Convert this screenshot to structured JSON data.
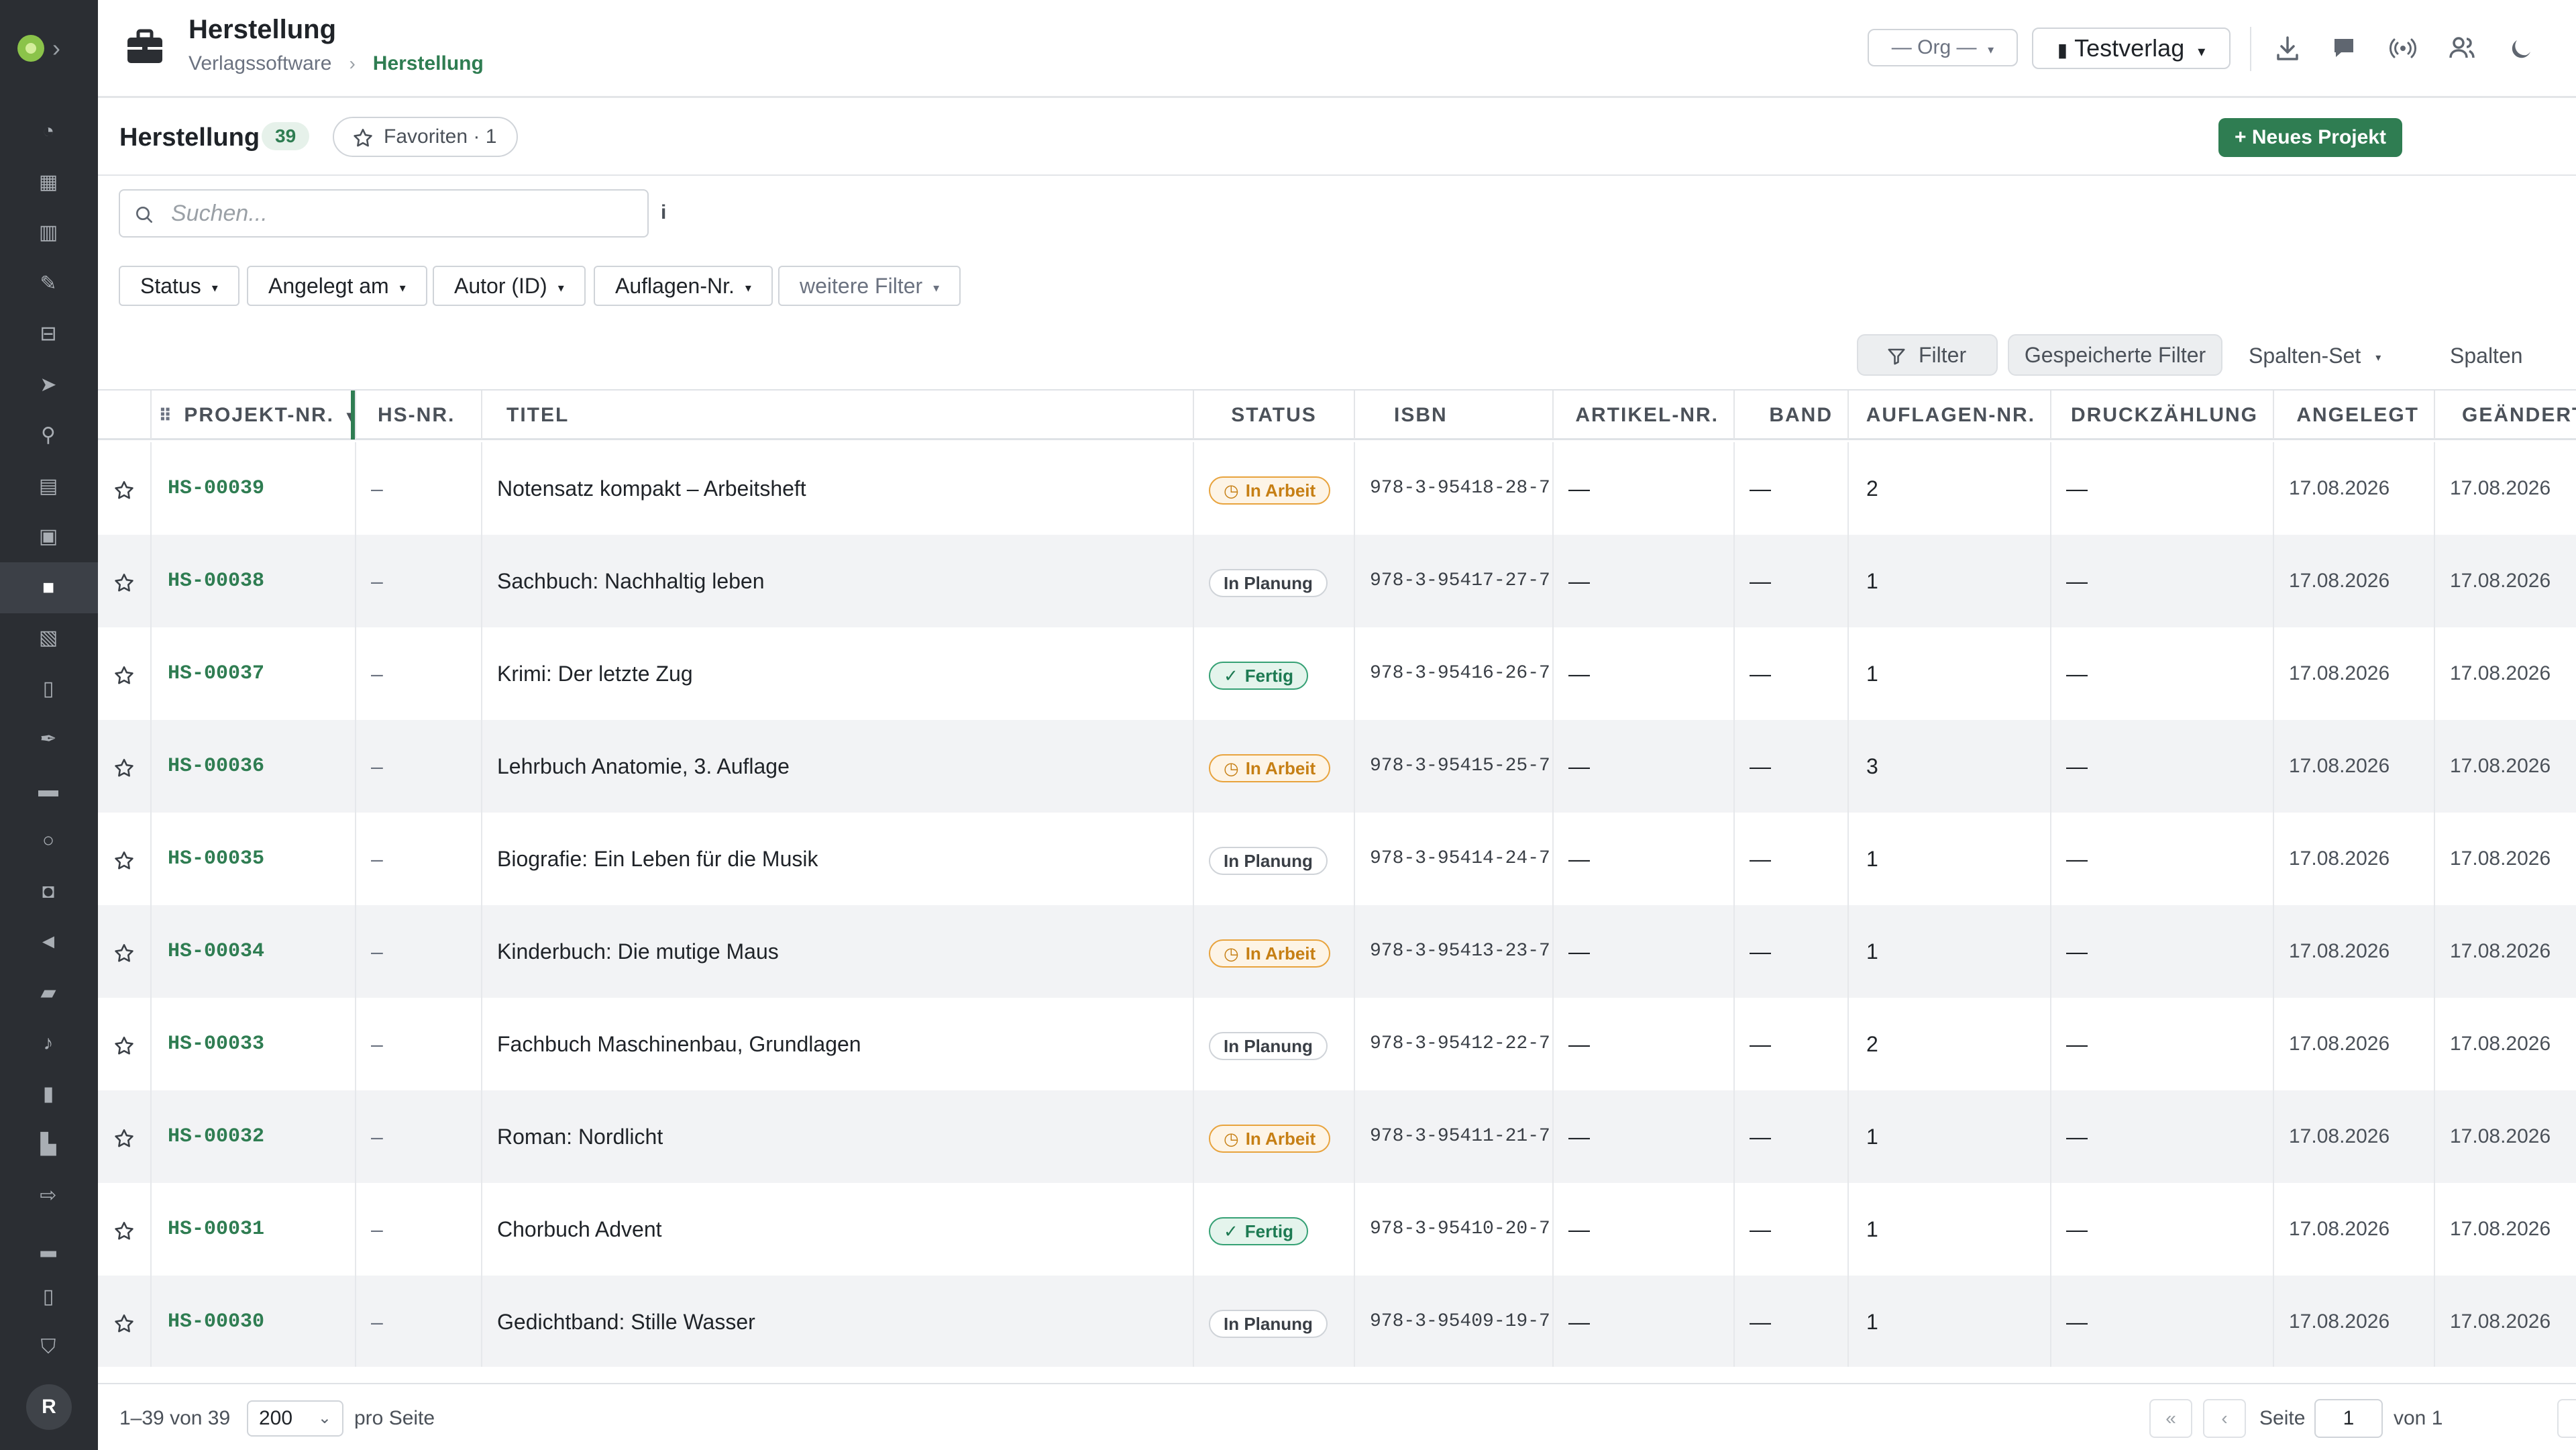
{
  "header": {
    "title": "Herstellung",
    "breadcrumb": [
      "Verlagssoftware",
      "Herstellung"
    ],
    "org_select": "— Org —",
    "publisher_select": "Testverlag"
  },
  "sidebar": {
    "icons": [
      "dashboard-icon",
      "calendar-icon",
      "board-icon",
      "user-edit-icon",
      "inbox-icon",
      "send-icon",
      "lightbulb-icon",
      "library-icon",
      "image-icon",
      "briefcase-icon",
      "card-icon",
      "book-icon",
      "feather-icon",
      "truck-icon",
      "circle-icon",
      "bag-icon",
      "megaphone-icon",
      "ticket-icon",
      "music-icon",
      "file-icon",
      "store-icon",
      "transfer-icon",
      "chart-icon",
      "receipt-icon",
      "shield-icon"
    ],
    "active_index": 9,
    "avatar": "R"
  },
  "toolbar": {
    "title": "Herstellung",
    "count": "39",
    "favorites": "Favoriten · 1",
    "new_project": "+ Neues Projekt",
    "more": "···"
  },
  "search": {
    "placeholder": "Suchen...",
    "info": "i"
  },
  "filters": {
    "chips": [
      "Status",
      "Angelegt am",
      "Autor (ID)",
      "Auflagen-Nr.",
      "weitere Filter"
    ],
    "filter_btn": "Filter",
    "saved_filters": "Gespeicherte Filter",
    "column_set": "Spalten-Set",
    "columns": "Spalten"
  },
  "table": {
    "columns": [
      "PROJEKT-NR.",
      "HS-NR.",
      "TITEL",
      "STATUS",
      "ISBN",
      "ARTIKEL-NR.",
      "BAND",
      "AUFLAGEN-NR.",
      "DRUCKZÄHLUNG",
      "ANGELEGT",
      "GEÄNDERT"
    ],
    "status_labels": {
      "arbeit": "In Arbeit",
      "planung": "In Planung",
      "fertig": "Fertig"
    },
    "rows": [
      {
        "pid": "HS-00039",
        "hs": "–",
        "title": "Notensatz kompakt – Arbeitsheft",
        "status": "arbeit",
        "isbn": "978-3-95418-28-7",
        "art": "—",
        "band": "—",
        "aufl": "2",
        "druck": "—",
        "created": "17.08.2026",
        "changed": "17.08.2026"
      },
      {
        "pid": "HS-00038",
        "hs": "–",
        "title": "Sachbuch: Nachhaltig leben",
        "status": "planung",
        "isbn": "978-3-95417-27-7",
        "art": "—",
        "band": "—",
        "aufl": "1",
        "druck": "—",
        "created": "17.08.2026",
        "changed": "17.08.2026"
      },
      {
        "pid": "HS-00037",
        "hs": "–",
        "title": "Krimi: Der letzte Zug",
        "status": "fertig",
        "isbn": "978-3-95416-26-7",
        "art": "—",
        "band": "—",
        "aufl": "1",
        "druck": "—",
        "created": "17.08.2026",
        "changed": "17.08.2026"
      },
      {
        "pid": "HS-00036",
        "hs": "–",
        "title": "Lehrbuch Anatomie, 3. Auflage",
        "status": "arbeit",
        "isbn": "978-3-95415-25-7",
        "art": "—",
        "band": "—",
        "aufl": "3",
        "druck": "—",
        "created": "17.08.2026",
        "changed": "17.08.2026"
      },
      {
        "pid": "HS-00035",
        "hs": "–",
        "title": "Biografie: Ein Leben für die Musik",
        "status": "planung",
        "isbn": "978-3-95414-24-7",
        "art": "—",
        "band": "—",
        "aufl": "1",
        "druck": "—",
        "created": "17.08.2026",
        "changed": "17.08.2026"
      },
      {
        "pid": "HS-00034",
        "hs": "–",
        "title": "Kinderbuch: Die mutige Maus",
        "status": "arbeit",
        "isbn": "978-3-95413-23-7",
        "art": "—",
        "band": "—",
        "aufl": "1",
        "druck": "—",
        "created": "17.08.2026",
        "changed": "17.08.2026"
      },
      {
        "pid": "HS-00033",
        "hs": "–",
        "title": "Fachbuch Maschinenbau, Grundlagen",
        "status": "planung",
        "isbn": "978-3-95412-22-7",
        "art": "—",
        "band": "—",
        "aufl": "2",
        "druck": "—",
        "created": "17.08.2026",
        "changed": "17.08.2026"
      },
      {
        "pid": "HS-00032",
        "hs": "–",
        "title": "Roman: Nordlicht",
        "status": "arbeit",
        "isbn": "978-3-95411-21-7",
        "art": "—",
        "band": "—",
        "aufl": "1",
        "druck": "—",
        "created": "17.08.2026",
        "changed": "17.08.2026"
      },
      {
        "pid": "HS-00031",
        "hs": "–",
        "title": "Chorbuch Advent",
        "status": "fertig",
        "isbn": "978-3-95410-20-7",
        "art": "—",
        "band": "—",
        "aufl": "1",
        "druck": "—",
        "created": "17.08.2026",
        "changed": "17.08.2026"
      },
      {
        "pid": "HS-00030",
        "hs": "–",
        "title": "Gedichtband: Stille Wasser",
        "status": "planung",
        "isbn": "978-3-95409-19-7",
        "art": "—",
        "band": "—",
        "aufl": "1",
        "druck": "—",
        "created": "17.08.2026",
        "changed": "17.08.2026"
      }
    ]
  },
  "footer": {
    "range": "1–39 von 39",
    "page_size": "200",
    "per_page": "pro Seite",
    "page_label": "Seite",
    "page": "1",
    "of_label": "von 1",
    "first": "«",
    "prev": "‹",
    "next": "›",
    "last": "»"
  },
  "colors": {
    "accent": "#2f7d52",
    "sidebar": "#2b2e33",
    "in_arbeit": "#e8a33d",
    "fertig": "#36a175"
  }
}
